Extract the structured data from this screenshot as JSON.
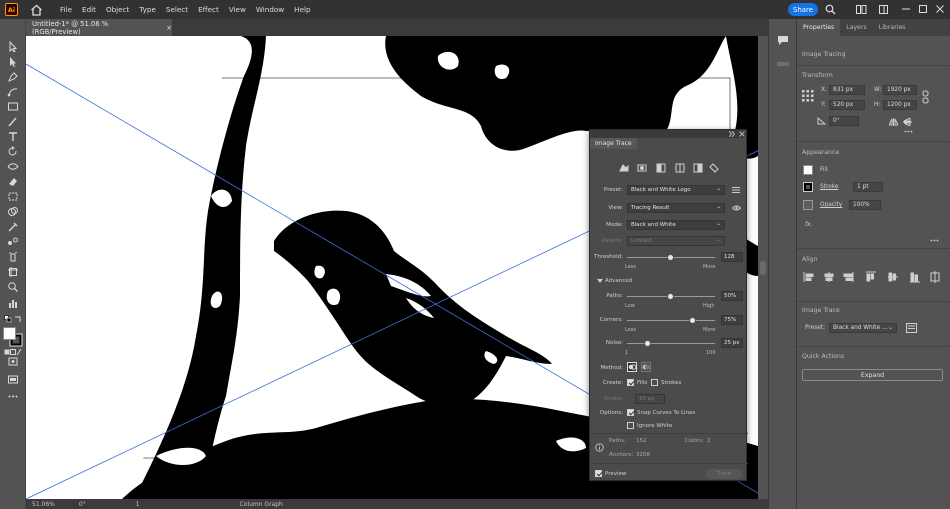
{
  "app": {
    "logo": "Ai",
    "menu": [
      "File",
      "Edit",
      "Object",
      "Type",
      "Select",
      "Effect",
      "View",
      "Window",
      "Help"
    ],
    "share": "Share"
  },
  "document": {
    "tab_title": "Untitled-1* @ 51.06 % (RGB/Preview)",
    "close": "×"
  },
  "status": {
    "zoom": "51.06%",
    "rotation": "0°",
    "artboard": "1",
    "tool": "Column Graph"
  },
  "properties": {
    "tabs": [
      "Properties",
      "Layers",
      "Libraries"
    ],
    "selection": "Image Tracing",
    "transform": {
      "title": "Transform",
      "x_label": "X:",
      "x": "831 px",
      "y_label": "Y:",
      "y": "520 px",
      "w_label": "W:",
      "w": "1920 px",
      "h_label": "H:",
      "h": "1200 px",
      "angle": "0°"
    },
    "appearance": {
      "title": "Appearance",
      "fill": "Fill",
      "stroke": "Stroke",
      "stroke_value": "1 pt",
      "opacity": "Opacity",
      "opacity_value": "100%",
      "fx": "fx."
    },
    "align": {
      "title": "Align"
    },
    "image_trace": {
      "title": "Image Trace",
      "preset_label": "Preset:",
      "preset": "Black and White ..."
    },
    "quick_actions": {
      "title": "Quick Actions",
      "expand": "Expand"
    }
  },
  "image_trace_panel": {
    "title": "Image Trace",
    "preset_label": "Preset:",
    "preset": "Black and White Logo",
    "view_label": "View:",
    "view": "Tracing Result",
    "mode_label": "Mode:",
    "mode": "Black and White",
    "palette_label": "Palette:",
    "palette": "Limited",
    "threshold_label": "Threshold:",
    "threshold": "128",
    "threshold_level": 128,
    "less": "Less",
    "more": "More",
    "advanced": "Advanced",
    "paths_label": "Paths:",
    "paths": "50%",
    "paths_level": 50,
    "low": "Low",
    "high": "High",
    "corners_label": "Corners:",
    "corners": "75%",
    "corners_level": 75,
    "noise_label": "Noise:",
    "noise": "25 px",
    "noise_level": 25,
    "noise_min": "1",
    "noise_max": "100",
    "method_label": "Method:",
    "create_label": "Create:",
    "fills": "Fills",
    "strokes": "Strokes",
    "stroke_label": "Stroke:",
    "stroke_value": "10 px",
    "options_label": "Options:",
    "snap": "Snap Curves To Lines",
    "ignore_white": "Ignore White",
    "stats": {
      "paths_label": "Paths:",
      "paths": "152",
      "colors_label": "Colors:",
      "colors": "2",
      "anchors_label": "Anchors:",
      "anchors": "3208"
    },
    "preview": "Preview",
    "trace": "Trace"
  }
}
